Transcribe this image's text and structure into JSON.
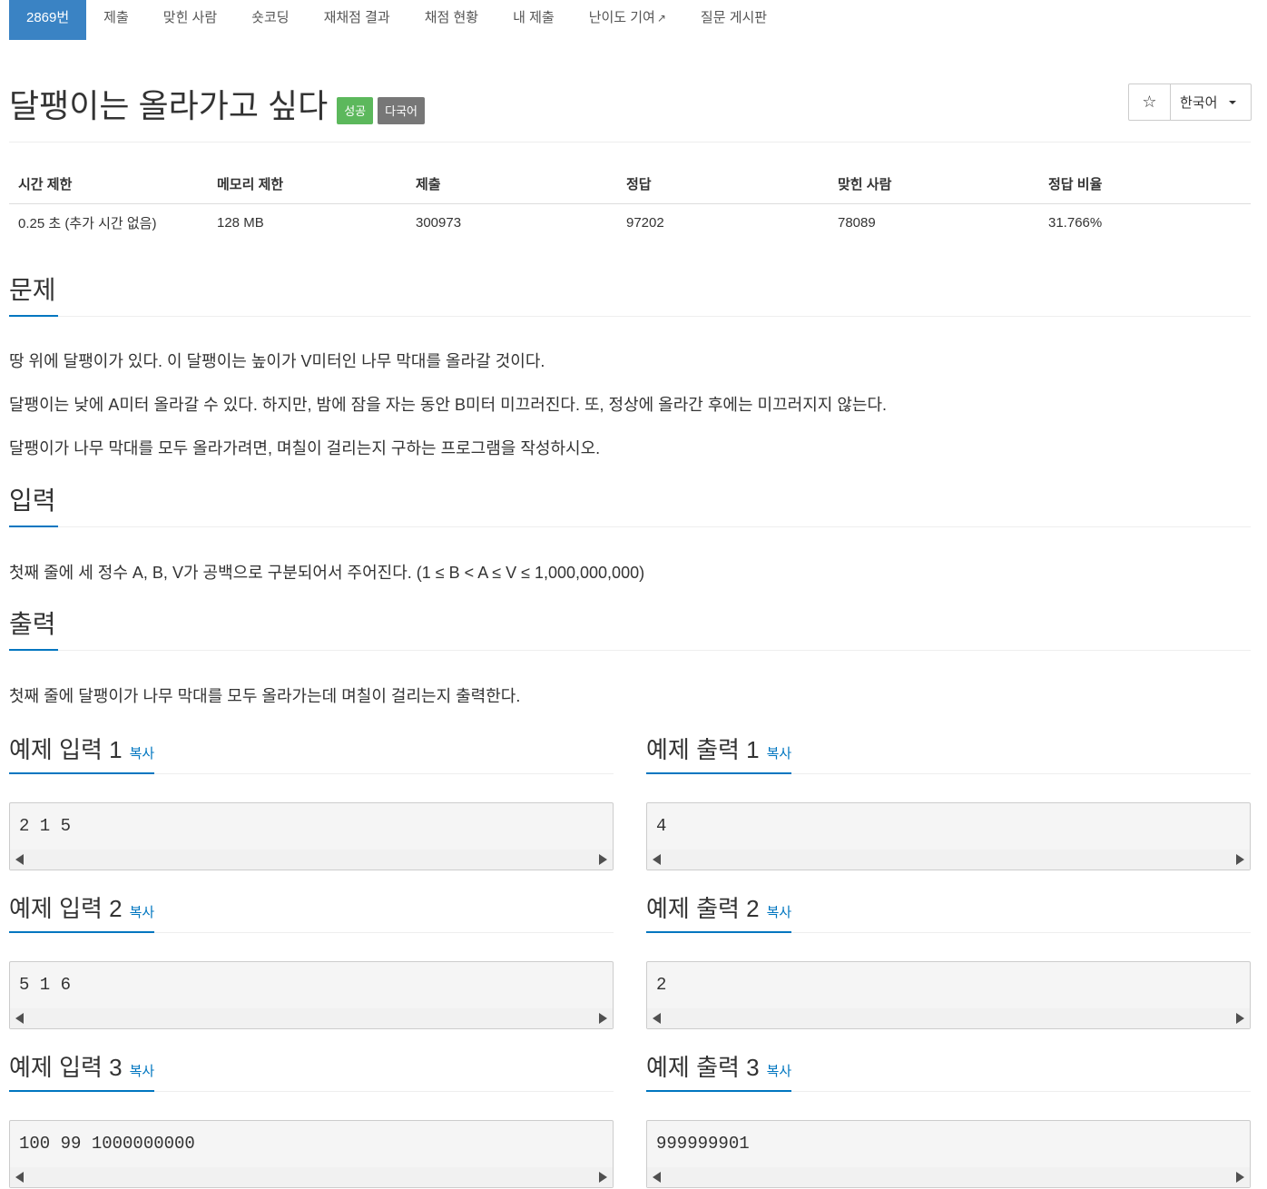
{
  "nav": {
    "tabs": [
      "2869번",
      "제출",
      "맞힌 사람",
      "숏코딩",
      "재채점 결과",
      "채점 현황",
      "내 제출",
      "난이도 기여",
      "질문 게시판"
    ],
    "active_index": 0
  },
  "problem": {
    "title": "달팽이는 올라가고 싶다",
    "labels": [
      "성공",
      "다국어"
    ]
  },
  "toolbar": {
    "star": "☆",
    "language": "한국어"
  },
  "info_table": {
    "headers": [
      "시간 제한",
      "메모리 제한",
      "제출",
      "정답",
      "맞힌 사람",
      "정답 비율"
    ],
    "values": [
      "0.25 초 (추가 시간 없음)",
      "128 MB",
      "300973",
      "97202",
      "78089",
      "31.766%"
    ]
  },
  "description": {
    "heading": "문제",
    "paragraphs": [
      "땅 위에 달팽이가 있다. 이 달팽이는 높이가 V미터인 나무 막대를 올라갈 것이다.",
      "달팽이는 낮에 A미터 올라갈 수 있다. 하지만, 밤에 잠을 자는 동안 B미터 미끄러진다. 또, 정상에 올라간 후에는 미끄러지지 않는다.",
      "달팽이가 나무 막대를 모두 올라가려면, 며칠이 걸리는지 구하는 프로그램을 작성하시오."
    ]
  },
  "input": {
    "heading": "입력",
    "text": "첫째 줄에 세 정수 A, B, V가 공백으로 구분되어서 주어진다. (1 ≤ B < A ≤ V ≤ 1,000,000,000)"
  },
  "output": {
    "heading": "출력",
    "text": "첫째 줄에 달팽이가 나무 막대를 모두 올라가는데 며칠이 걸리는지 출력한다."
  },
  "copy_label": "복사",
  "samples": [
    {
      "input_title": "예제 입력 1",
      "input": "2 1 5",
      "output_title": "예제 출력 1",
      "output": "4"
    },
    {
      "input_title": "예제 입력 2",
      "input": "5 1 6",
      "output_title": "예제 출력 2",
      "output": "2"
    },
    {
      "input_title": "예제 입력 3",
      "input": "100 99 1000000000",
      "output_title": "예제 출력 3",
      "output": "999999901"
    }
  ]
}
